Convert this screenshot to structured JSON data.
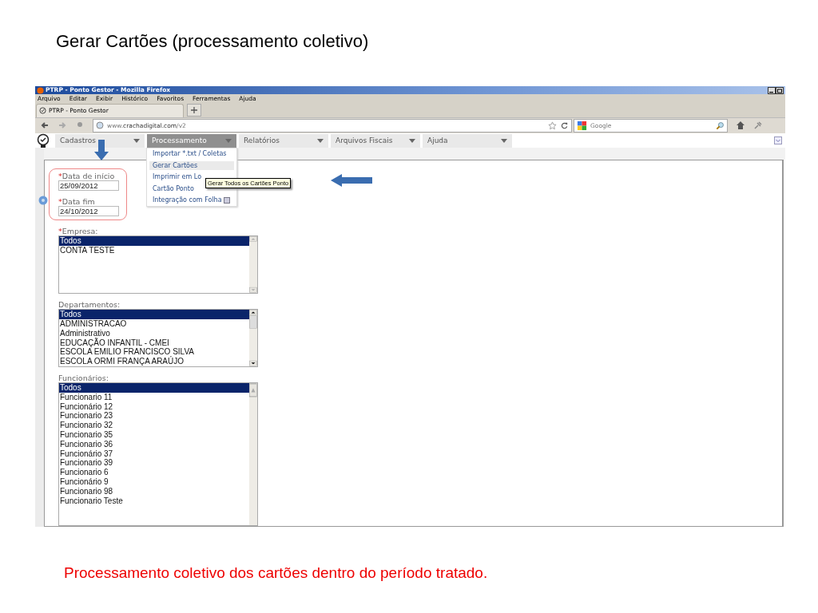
{
  "slide_title": "Gerar Cartões (processamento coletivo)",
  "browser": {
    "title": "PTRP - Ponto Gestor - Mozilla Firefox",
    "menu": [
      "Arquivo",
      "Editar",
      "Exibir",
      "Histórico",
      "Favoritos",
      "Ferramentas",
      "Ajuda"
    ],
    "tab": {
      "label": "PTRP - Ponto Gestor"
    },
    "url": "www.**crachadigital.com**/v2",
    "search": {
      "placeholder": "Google"
    }
  },
  "app_menu": [
    {
      "label": "Cadastros",
      "selected": false
    },
    {
      "label": "Processamento",
      "selected": true
    },
    {
      "label": "Relatórios",
      "selected": false
    },
    {
      "label": "Arquivos Fiscais",
      "selected": false
    },
    {
      "label": "Ajuda",
      "selected": false
    }
  ],
  "dropdown": [
    {
      "label": "Importar *.txt / Coletas",
      "selected": false,
      "submenu": false
    },
    {
      "label": "Gerar Cartões",
      "selected": true,
      "submenu": false
    },
    {
      "label": "Imprimir em Lo",
      "selected": false,
      "submenu": false
    },
    {
      "label": "Cartão Ponto",
      "selected": false,
      "submenu": false
    },
    {
      "label": "Integração com Folha",
      "selected": false,
      "submenu": true
    }
  ],
  "tooltip": "Gerar Todos os Cartões Ponto",
  "date_fields": [
    {
      "mark": "*",
      "label": "Data de início",
      "value": "25/09/2012"
    },
    {
      "mark": "*",
      "label": "Data fim",
      "value": "24/10/2012"
    }
  ],
  "lists": [
    {
      "mark": "*",
      "label": "Empresa:",
      "thumb": false,
      "items": [
        {
          "label": "Todos",
          "selected": true
        },
        {
          "label": "CONTA TESTE",
          "selected": false
        }
      ]
    },
    {
      "label": "Departamentos:",
      "thumb": true,
      "items": [
        {
          "label": "Todos",
          "selected": true
        },
        {
          "label": "ADMINISTRACAO",
          "selected": false
        },
        {
          "label": "Administrativo",
          "selected": false
        },
        {
          "label": "EDUCAÇÃO INFANTIL - CMEI",
          "selected": false
        },
        {
          "label": "ESCOLA EMILIO FRANCISCO SILVA",
          "selected": false
        },
        {
          "label": "ESCOLA ORMI FRANÇA ARAÚJO",
          "selected": false
        }
      ]
    },
    {
      "label": "Funcionários:",
      "thumb": false,
      "items": [
        {
          "label": "Todos",
          "selected": true
        },
        {
          "label": "Funcionario 11",
          "selected": false
        },
        {
          "label": "Funcionário 12",
          "selected": false
        },
        {
          "label": "Funcionario 23",
          "selected": false
        },
        {
          "label": "Funcionario 32",
          "selected": false
        },
        {
          "label": "Funcionario 35",
          "selected": false
        },
        {
          "label": "Funcionario 36",
          "selected": false
        },
        {
          "label": "Funcionário 37",
          "selected": false
        },
        {
          "label": "Funcionario 39",
          "selected": false
        },
        {
          "label": "Funcionario 6",
          "selected": false
        },
        {
          "label": "Funcionário 9",
          "selected": false
        },
        {
          "label": "Funcionario 98",
          "selected": false
        },
        {
          "label": "Funcionario Teste",
          "selected": false
        }
      ]
    }
  ],
  "caption": "Processamento coletivo dos cartões dentro do período tratado."
}
